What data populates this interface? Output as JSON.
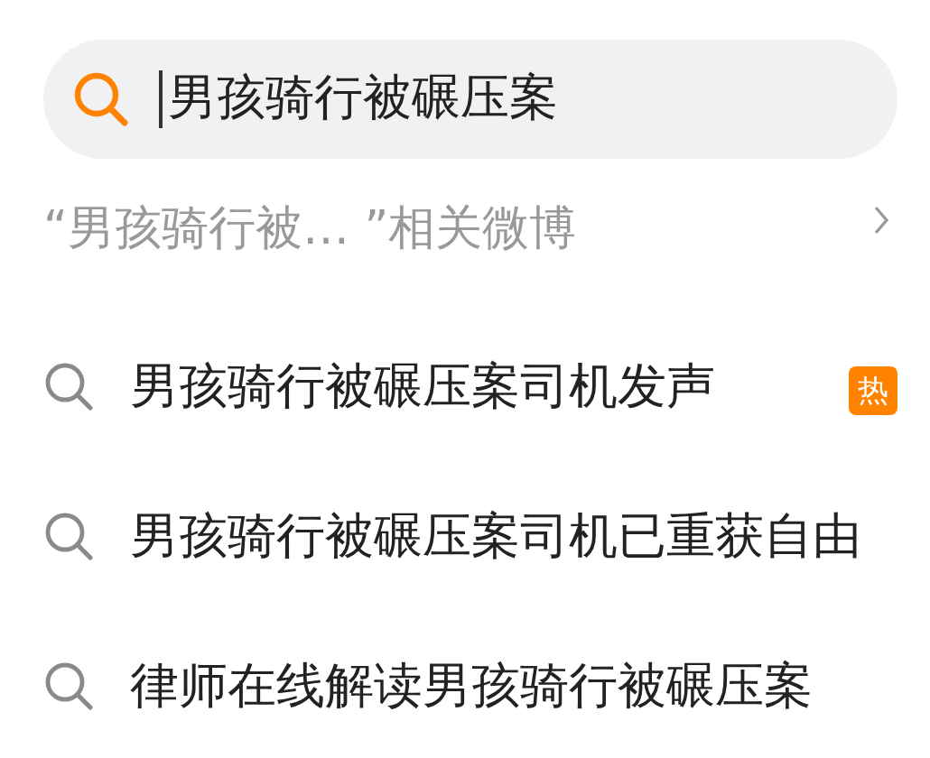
{
  "search": {
    "value": "男孩骑行被碾压案"
  },
  "related": {
    "label": "“男孩骑行被… ”相关微博"
  },
  "suggestions": [
    {
      "text": "男孩骑行被碾压案司机发声",
      "badge": "热"
    },
    {
      "text": "男孩骑行被碾压案司机已重获自由"
    },
    {
      "text": "律师在线解读男孩骑行被碾压案"
    }
  ]
}
